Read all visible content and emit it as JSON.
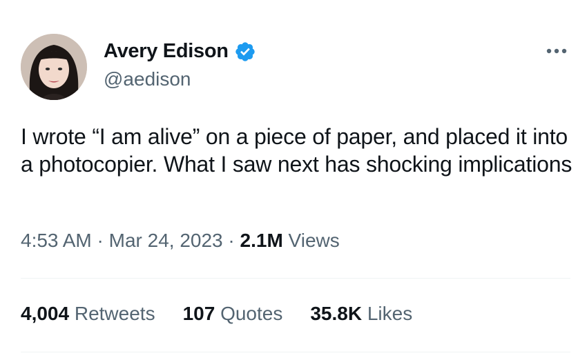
{
  "author": {
    "display_name": "Avery Edison",
    "handle": "@aedison",
    "avatar": "profile-photo",
    "verified": true,
    "verified_color": "#1d9bf0"
  },
  "tweet": {
    "text": "I wrote “I am alive” on a piece of paper, and placed it into a photocopier. What I saw next has shocking implications",
    "time": "4:53 AM",
    "separator": "·",
    "date": "Mar 24, 2023",
    "views_count": "2.1M",
    "views_label": "Views"
  },
  "stats": {
    "retweets_count": "4,004",
    "retweets_label": "Retweets",
    "quotes_count": "107",
    "quotes_label": "Quotes",
    "likes_count": "35.8K",
    "likes_label": "Likes"
  },
  "icons": {
    "more": "more-horizontal-icon",
    "verified": "verified-badge-icon"
  },
  "colors": {
    "text_primary": "#0f1419",
    "text_secondary": "#536471",
    "divider": "#eff3f4"
  }
}
